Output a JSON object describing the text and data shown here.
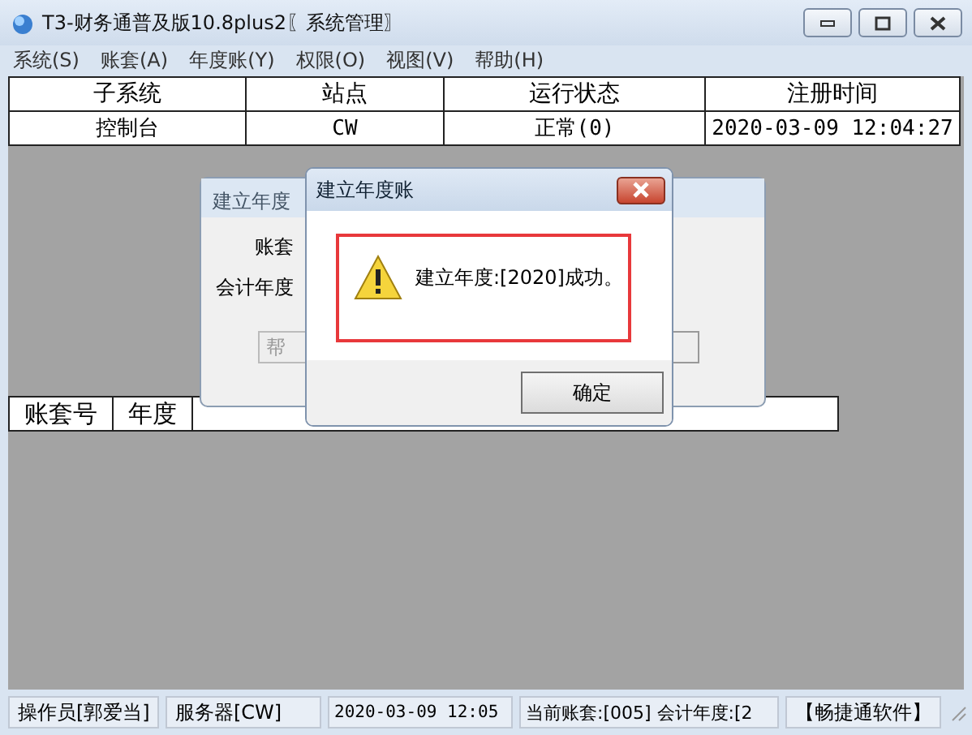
{
  "window": {
    "title": "T3-财务通普及版10.8plus2〖系统管理〗"
  },
  "menu": [
    "系统(S)",
    "账套(A)",
    "年度账(Y)",
    "权限(O)",
    "视图(V)",
    "帮助(H)"
  ],
  "subsystem_table": {
    "columns": [
      "子系统",
      "站点",
      "运行状态",
      "注册时间"
    ],
    "rows": [
      [
        "控制台",
        "CW",
        "正常(0)",
        "2020-03-09 12:04:27"
      ]
    ]
  },
  "account_table": {
    "columns": [
      "账套号",
      "年度"
    ]
  },
  "back_dialog": {
    "title": "建立年度",
    "labels": [
      "账套",
      "会计年度"
    ],
    "buttons": [
      "帮"
    ]
  },
  "message_box": {
    "title": "建立年度账",
    "message": "建立年度:[2020]成功。",
    "button": "确定"
  },
  "status_bar": [
    "操作员[郭爱当]",
    "服务器[CW]",
    "2020-03-09 12:05",
    "当前账套:[005] 会计年度:[2",
    "【畅捷通软件】"
  ]
}
